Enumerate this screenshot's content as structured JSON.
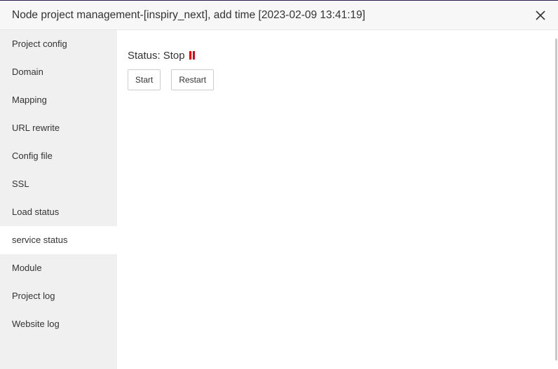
{
  "dialog": {
    "title": "Node project management-[inspiry_next], add time [2023-02-09 13:41:19]",
    "close_icon": "close-icon"
  },
  "sidebar": {
    "items": [
      {
        "label": "Project config"
      },
      {
        "label": "Domain"
      },
      {
        "label": "Mapping"
      },
      {
        "label": "URL rewrite"
      },
      {
        "label": "Config file"
      },
      {
        "label": "SSL"
      },
      {
        "label": "Load status"
      },
      {
        "label": "service status",
        "active": true
      },
      {
        "label": "Module"
      },
      {
        "label": "Project log"
      },
      {
        "label": "Website log"
      }
    ]
  },
  "main": {
    "status_label": "Status:",
    "status_value": "Stop",
    "status_icon": "pause-icon",
    "status_color": "#e60012",
    "buttons": {
      "start": "Start",
      "restart": "Restart"
    }
  }
}
